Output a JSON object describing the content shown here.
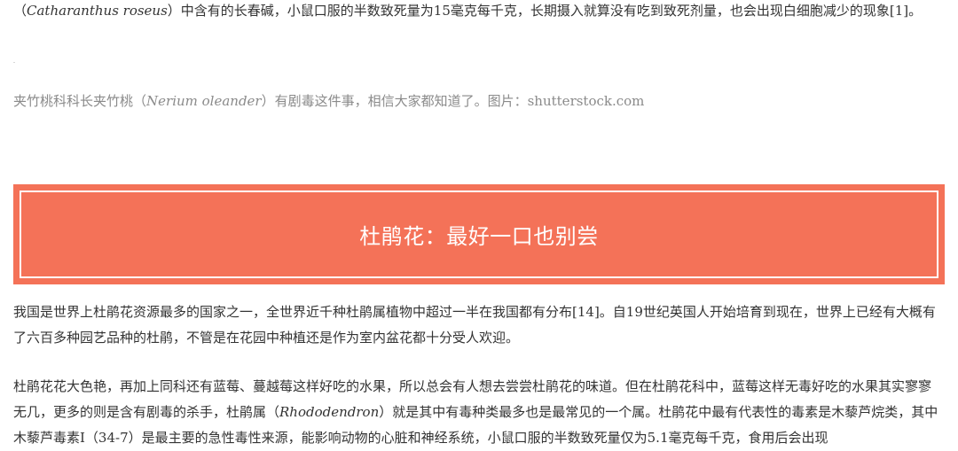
{
  "top_paragraph": {
    "pre": "（",
    "latin": "Catharanthus roseus",
    "post": "）中含有的长春碱，小鼠口服的半数致死量为15毫克每千克，长期摄入就算没有吃到致死剂量，也会出现白细胞减少的现象[1]。"
  },
  "caption": {
    "pre": "夹竹桃科科长夹竹桃（",
    "latin": "Nerium oleander",
    "post": "）有剧毒这件事，相信大家都知道了。图片：shutterstock.com"
  },
  "section": {
    "title": "杜鹃花：最好一口也别尝",
    "bg_color": "#f47258"
  },
  "paragraph1": {
    "text": "我国是世界上杜鹃花资源最多的国家之一，全世界近千种杜鹃属植物中超过一半在我国都有分布[14]。自19世纪英国人开始培育到现在，世界上已经有大概有了六百多种园艺品种的杜鹃，不管是在花园中种植还是作为室内盆花都十分受人欢迎。"
  },
  "paragraph2": {
    "pre": "杜鹃花花大色艳，再加上同科还有蓝莓、蔓越莓这样好吃的水果，所以总会有人想去尝尝杜鹃花的味道。但在杜鹃花科中，蓝莓这样无毒好吃的水果其实寥寥无几，更多的则是含有剧毒的杀手，杜鹃属（",
    "latin": "Rhododendron",
    "post": "）就是其中有毒种类最多也是最常见的一个属。杜鹃花中最有代表性的毒素是木藜芦烷类，其中木藜芦毒素I（34-7）是最主要的急性毒性来源，能影响动物的心脏和神经系统，小鼠口服的半数致死量仅为5.1毫克每千克，食用后会出现"
  }
}
